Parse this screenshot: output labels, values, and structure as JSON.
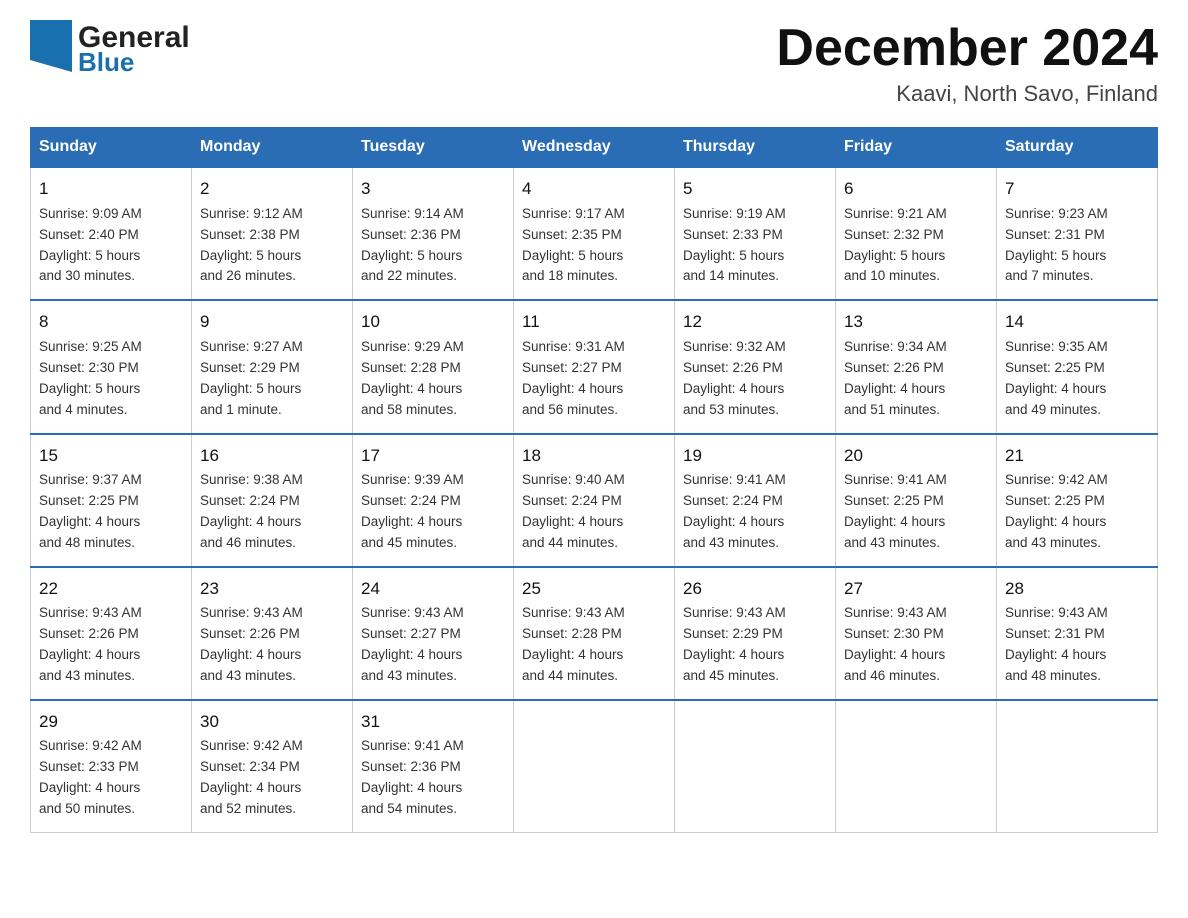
{
  "header": {
    "logo_general": "General",
    "logo_blue": "Blue",
    "month_title": "December 2024",
    "subtitle": "Kaavi, North Savo, Finland"
  },
  "calendar": {
    "weekdays": [
      "Sunday",
      "Monday",
      "Tuesday",
      "Wednesday",
      "Thursday",
      "Friday",
      "Saturday"
    ],
    "weeks": [
      [
        {
          "day": "1",
          "sunrise": "Sunrise: 9:09 AM",
          "sunset": "Sunset: 2:40 PM",
          "daylight": "Daylight: 5 hours",
          "daylight2": "and 30 minutes."
        },
        {
          "day": "2",
          "sunrise": "Sunrise: 9:12 AM",
          "sunset": "Sunset: 2:38 PM",
          "daylight": "Daylight: 5 hours",
          "daylight2": "and 26 minutes."
        },
        {
          "day": "3",
          "sunrise": "Sunrise: 9:14 AM",
          "sunset": "Sunset: 2:36 PM",
          "daylight": "Daylight: 5 hours",
          "daylight2": "and 22 minutes."
        },
        {
          "day": "4",
          "sunrise": "Sunrise: 9:17 AM",
          "sunset": "Sunset: 2:35 PM",
          "daylight": "Daylight: 5 hours",
          "daylight2": "and 18 minutes."
        },
        {
          "day": "5",
          "sunrise": "Sunrise: 9:19 AM",
          "sunset": "Sunset: 2:33 PM",
          "daylight": "Daylight: 5 hours",
          "daylight2": "and 14 minutes."
        },
        {
          "day": "6",
          "sunrise": "Sunrise: 9:21 AM",
          "sunset": "Sunset: 2:32 PM",
          "daylight": "Daylight: 5 hours",
          "daylight2": "and 10 minutes."
        },
        {
          "day": "7",
          "sunrise": "Sunrise: 9:23 AM",
          "sunset": "Sunset: 2:31 PM",
          "daylight": "Daylight: 5 hours",
          "daylight2": "and 7 minutes."
        }
      ],
      [
        {
          "day": "8",
          "sunrise": "Sunrise: 9:25 AM",
          "sunset": "Sunset: 2:30 PM",
          "daylight": "Daylight: 5 hours",
          "daylight2": "and 4 minutes."
        },
        {
          "day": "9",
          "sunrise": "Sunrise: 9:27 AM",
          "sunset": "Sunset: 2:29 PM",
          "daylight": "Daylight: 5 hours",
          "daylight2": "and 1 minute."
        },
        {
          "day": "10",
          "sunrise": "Sunrise: 9:29 AM",
          "sunset": "Sunset: 2:28 PM",
          "daylight": "Daylight: 4 hours",
          "daylight2": "and 58 minutes."
        },
        {
          "day": "11",
          "sunrise": "Sunrise: 9:31 AM",
          "sunset": "Sunset: 2:27 PM",
          "daylight": "Daylight: 4 hours",
          "daylight2": "and 56 minutes."
        },
        {
          "day": "12",
          "sunrise": "Sunrise: 9:32 AM",
          "sunset": "Sunset: 2:26 PM",
          "daylight": "Daylight: 4 hours",
          "daylight2": "and 53 minutes."
        },
        {
          "day": "13",
          "sunrise": "Sunrise: 9:34 AM",
          "sunset": "Sunset: 2:26 PM",
          "daylight": "Daylight: 4 hours",
          "daylight2": "and 51 minutes."
        },
        {
          "day": "14",
          "sunrise": "Sunrise: 9:35 AM",
          "sunset": "Sunset: 2:25 PM",
          "daylight": "Daylight: 4 hours",
          "daylight2": "and 49 minutes."
        }
      ],
      [
        {
          "day": "15",
          "sunrise": "Sunrise: 9:37 AM",
          "sunset": "Sunset: 2:25 PM",
          "daylight": "Daylight: 4 hours",
          "daylight2": "and 48 minutes."
        },
        {
          "day": "16",
          "sunrise": "Sunrise: 9:38 AM",
          "sunset": "Sunset: 2:24 PM",
          "daylight": "Daylight: 4 hours",
          "daylight2": "and 46 minutes."
        },
        {
          "day": "17",
          "sunrise": "Sunrise: 9:39 AM",
          "sunset": "Sunset: 2:24 PM",
          "daylight": "Daylight: 4 hours",
          "daylight2": "and 45 minutes."
        },
        {
          "day": "18",
          "sunrise": "Sunrise: 9:40 AM",
          "sunset": "Sunset: 2:24 PM",
          "daylight": "Daylight: 4 hours",
          "daylight2": "and 44 minutes."
        },
        {
          "day": "19",
          "sunrise": "Sunrise: 9:41 AM",
          "sunset": "Sunset: 2:24 PM",
          "daylight": "Daylight: 4 hours",
          "daylight2": "and 43 minutes."
        },
        {
          "day": "20",
          "sunrise": "Sunrise: 9:41 AM",
          "sunset": "Sunset: 2:25 PM",
          "daylight": "Daylight: 4 hours",
          "daylight2": "and 43 minutes."
        },
        {
          "day": "21",
          "sunrise": "Sunrise: 9:42 AM",
          "sunset": "Sunset: 2:25 PM",
          "daylight": "Daylight: 4 hours",
          "daylight2": "and 43 minutes."
        }
      ],
      [
        {
          "day": "22",
          "sunrise": "Sunrise: 9:43 AM",
          "sunset": "Sunset: 2:26 PM",
          "daylight": "Daylight: 4 hours",
          "daylight2": "and 43 minutes."
        },
        {
          "day": "23",
          "sunrise": "Sunrise: 9:43 AM",
          "sunset": "Sunset: 2:26 PM",
          "daylight": "Daylight: 4 hours",
          "daylight2": "and 43 minutes."
        },
        {
          "day": "24",
          "sunrise": "Sunrise: 9:43 AM",
          "sunset": "Sunset: 2:27 PM",
          "daylight": "Daylight: 4 hours",
          "daylight2": "and 43 minutes."
        },
        {
          "day": "25",
          "sunrise": "Sunrise: 9:43 AM",
          "sunset": "Sunset: 2:28 PM",
          "daylight": "Daylight: 4 hours",
          "daylight2": "and 44 minutes."
        },
        {
          "day": "26",
          "sunrise": "Sunrise: 9:43 AM",
          "sunset": "Sunset: 2:29 PM",
          "daylight": "Daylight: 4 hours",
          "daylight2": "and 45 minutes."
        },
        {
          "day": "27",
          "sunrise": "Sunrise: 9:43 AM",
          "sunset": "Sunset: 2:30 PM",
          "daylight": "Daylight: 4 hours",
          "daylight2": "and 46 minutes."
        },
        {
          "day": "28",
          "sunrise": "Sunrise: 9:43 AM",
          "sunset": "Sunset: 2:31 PM",
          "daylight": "Daylight: 4 hours",
          "daylight2": "and 48 minutes."
        }
      ],
      [
        {
          "day": "29",
          "sunrise": "Sunrise: 9:42 AM",
          "sunset": "Sunset: 2:33 PM",
          "daylight": "Daylight: 4 hours",
          "daylight2": "and 50 minutes."
        },
        {
          "day": "30",
          "sunrise": "Sunrise: 9:42 AM",
          "sunset": "Sunset: 2:34 PM",
          "daylight": "Daylight: 4 hours",
          "daylight2": "and 52 minutes."
        },
        {
          "day": "31",
          "sunrise": "Sunrise: 9:41 AM",
          "sunset": "Sunset: 2:36 PM",
          "daylight": "Daylight: 4 hours",
          "daylight2": "and 54 minutes."
        },
        null,
        null,
        null,
        null
      ]
    ]
  }
}
